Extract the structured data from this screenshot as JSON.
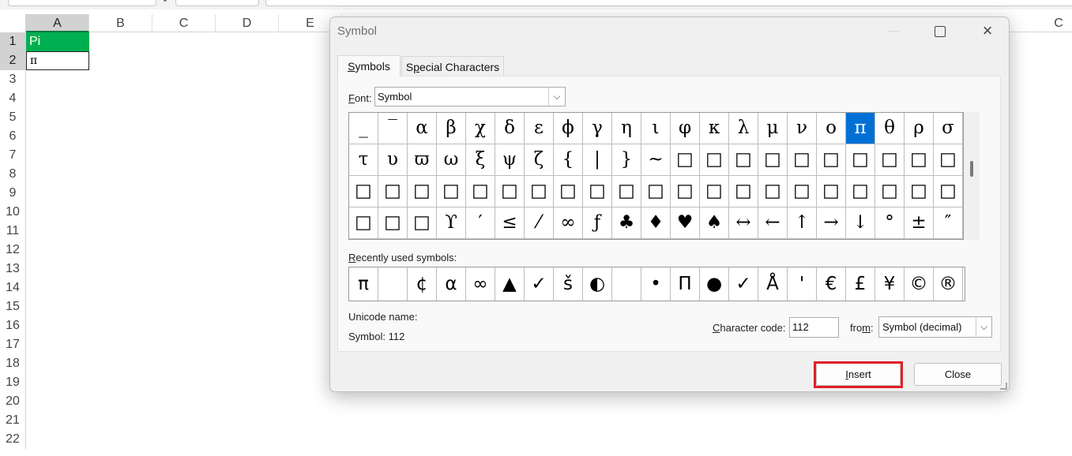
{
  "spreadsheet": {
    "columns": [
      "A",
      "B",
      "C",
      "D",
      "E",
      "C"
    ],
    "rows": [
      "1",
      "2",
      "3",
      "4",
      "5",
      "6",
      "7",
      "8",
      "9",
      "10",
      "11",
      "12",
      "13",
      "14",
      "15",
      "16",
      "17",
      "18",
      "19",
      "20",
      "21",
      "22"
    ],
    "cells": {
      "a1": "Pi",
      "a2": "π"
    },
    "colors": {
      "header_fill": "#00b050",
      "selected_header": "#d2d2d2"
    }
  },
  "dialog": {
    "title": "Symbol",
    "tabs": [
      {
        "pre": "",
        "u": "S",
        "post": "ymbols"
      },
      {
        "pre": "S",
        "u": "p",
        "post": "ecial Characters"
      }
    ],
    "font": {
      "pre": "",
      "u": "F",
      "post": "ont:",
      "value": "Symbol"
    },
    "symbol_grid": [
      [
        "_",
        "‾",
        "α",
        "β",
        "χ",
        "δ",
        "ε",
        "ϕ",
        "γ",
        "η",
        "ι",
        "φ",
        "κ",
        "λ",
        "μ",
        "ν",
        "ο",
        "π",
        "θ",
        "ρ",
        "σ"
      ],
      [
        "τ",
        "υ",
        "ϖ",
        "ω",
        "ξ",
        "ψ",
        "ζ",
        "{",
        "|",
        "}",
        "~",
        "□",
        "□",
        "□",
        "□",
        "□",
        "□",
        "□",
        "□",
        "□",
        "□"
      ],
      [
        "□",
        "□",
        "□",
        "□",
        "□",
        "□",
        "□",
        "□",
        "□",
        "□",
        "□",
        "□",
        "□",
        "□",
        "□",
        "□",
        "□",
        "□",
        "□",
        "□",
        "□"
      ],
      [
        "□",
        "□",
        "□",
        "ϒ",
        "′",
        "≤",
        "⁄",
        "∞",
        "ƒ",
        "♣",
        "♦",
        "♥",
        "♠",
        "↔",
        "←",
        "↑",
        "→",
        "↓",
        "°",
        "±",
        "″"
      ]
    ],
    "selected_symbol": "π",
    "recent": {
      "pre": "",
      "u": "R",
      "post": "ecently used symbols:",
      "symbols": [
        "π",
        "",
        "¢",
        "α",
        "∞",
        "▲",
        "✓",
        "š",
        "◐",
        "",
        "•",
        "Π",
        "●",
        "✓",
        "Å",
        "'",
        "€",
        "£",
        "¥",
        "©",
        "®"
      ]
    },
    "unicode_name_label": "Unicode name:",
    "unicode_name_value": "Symbol: 112",
    "character_code": {
      "pre": "",
      "u": "C",
      "post": "haracter code:",
      "value": "112"
    },
    "from": {
      "pre": "fro",
      "u": "m",
      "post": ":",
      "value": "Symbol (decimal)"
    },
    "buttons": {
      "insert": {
        "pre": "",
        "u": "I",
        "post": "nsert"
      },
      "close": "Close"
    },
    "highlight_color": "#e0202a",
    "selection_color": "#0070d6",
    "icons": [
      "minimize-icon",
      "maximize-icon",
      "close-icon",
      "chevron-down-icon",
      "resize-grip-icon"
    ]
  }
}
